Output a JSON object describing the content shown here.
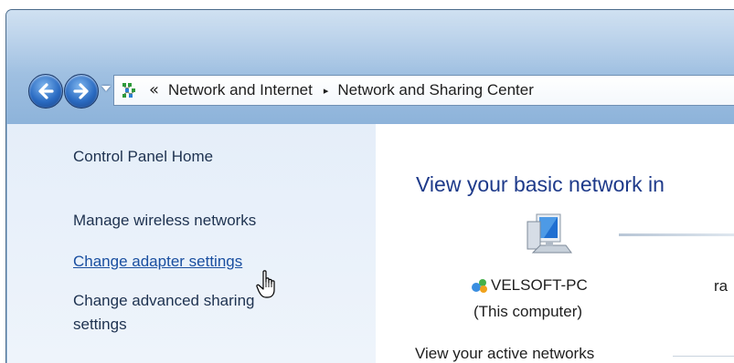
{
  "breadcrumb": {
    "overflow": "«",
    "items": [
      "Network and Internet",
      "Network and Sharing Center"
    ],
    "separator": "▸"
  },
  "sidebar": {
    "items": [
      {
        "label": "Control Panel Home"
      },
      {
        "label": "Manage wireless networks"
      },
      {
        "label": "Change adapter settings"
      },
      {
        "label": "Change advanced sharing"
      },
      {
        "label": "settings"
      }
    ]
  },
  "main": {
    "title": "View your basic network in",
    "computer": {
      "name": "VELSOFT-PC",
      "subtitle": "(This computer)"
    },
    "right_partial": "ra",
    "active_networks_label": "View your active networks"
  },
  "icons": {
    "back": "back-arrow-icon",
    "forward": "forward-arrow-icon",
    "recent": "chevron-down-icon",
    "control_panel": "network-control-panel-icon",
    "computer": "computer-icon",
    "homegroup": "homegroup-icon",
    "cursor": "hand-cursor-icon"
  },
  "colors": {
    "frame": "#a4c3e3",
    "sidebar_bg": "#e5eef9",
    "link": "#1a4fa0",
    "title": "#1e3a8a"
  }
}
